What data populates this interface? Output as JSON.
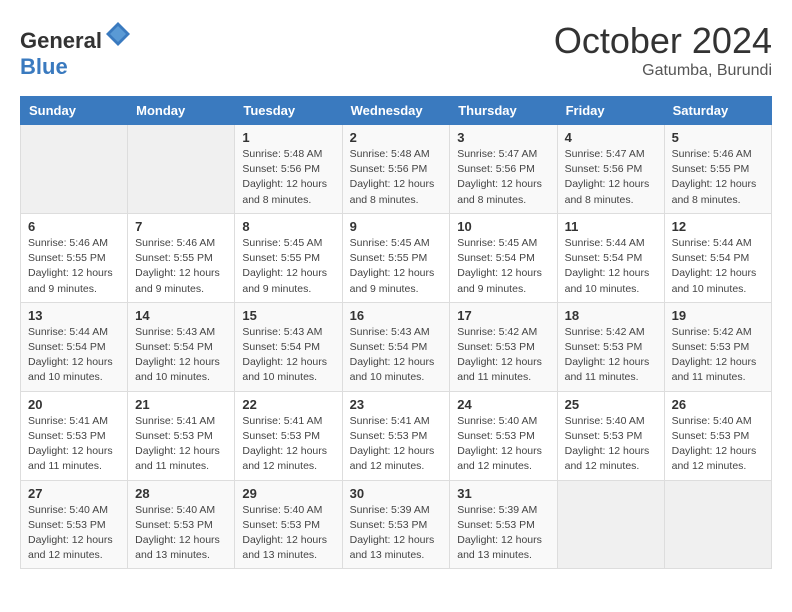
{
  "header": {
    "logo_general": "General",
    "logo_blue": "Blue",
    "month_title": "October 2024",
    "location": "Gatumba, Burundi"
  },
  "days_of_week": [
    "Sunday",
    "Monday",
    "Tuesday",
    "Wednesday",
    "Thursday",
    "Friday",
    "Saturday"
  ],
  "weeks": [
    [
      {
        "day": "",
        "detail": ""
      },
      {
        "day": "",
        "detail": ""
      },
      {
        "day": "1",
        "detail": "Sunrise: 5:48 AM\nSunset: 5:56 PM\nDaylight: 12 hours and 8 minutes."
      },
      {
        "day": "2",
        "detail": "Sunrise: 5:48 AM\nSunset: 5:56 PM\nDaylight: 12 hours and 8 minutes."
      },
      {
        "day": "3",
        "detail": "Sunrise: 5:47 AM\nSunset: 5:56 PM\nDaylight: 12 hours and 8 minutes."
      },
      {
        "day": "4",
        "detail": "Sunrise: 5:47 AM\nSunset: 5:56 PM\nDaylight: 12 hours and 8 minutes."
      },
      {
        "day": "5",
        "detail": "Sunrise: 5:46 AM\nSunset: 5:55 PM\nDaylight: 12 hours and 8 minutes."
      }
    ],
    [
      {
        "day": "6",
        "detail": "Sunrise: 5:46 AM\nSunset: 5:55 PM\nDaylight: 12 hours and 9 minutes."
      },
      {
        "day": "7",
        "detail": "Sunrise: 5:46 AM\nSunset: 5:55 PM\nDaylight: 12 hours and 9 minutes."
      },
      {
        "day": "8",
        "detail": "Sunrise: 5:45 AM\nSunset: 5:55 PM\nDaylight: 12 hours and 9 minutes."
      },
      {
        "day": "9",
        "detail": "Sunrise: 5:45 AM\nSunset: 5:55 PM\nDaylight: 12 hours and 9 minutes."
      },
      {
        "day": "10",
        "detail": "Sunrise: 5:45 AM\nSunset: 5:54 PM\nDaylight: 12 hours and 9 minutes."
      },
      {
        "day": "11",
        "detail": "Sunrise: 5:44 AM\nSunset: 5:54 PM\nDaylight: 12 hours and 10 minutes."
      },
      {
        "day": "12",
        "detail": "Sunrise: 5:44 AM\nSunset: 5:54 PM\nDaylight: 12 hours and 10 minutes."
      }
    ],
    [
      {
        "day": "13",
        "detail": "Sunrise: 5:44 AM\nSunset: 5:54 PM\nDaylight: 12 hours and 10 minutes."
      },
      {
        "day": "14",
        "detail": "Sunrise: 5:43 AM\nSunset: 5:54 PM\nDaylight: 12 hours and 10 minutes."
      },
      {
        "day": "15",
        "detail": "Sunrise: 5:43 AM\nSunset: 5:54 PM\nDaylight: 12 hours and 10 minutes."
      },
      {
        "day": "16",
        "detail": "Sunrise: 5:43 AM\nSunset: 5:54 PM\nDaylight: 12 hours and 10 minutes."
      },
      {
        "day": "17",
        "detail": "Sunrise: 5:42 AM\nSunset: 5:53 PM\nDaylight: 12 hours and 11 minutes."
      },
      {
        "day": "18",
        "detail": "Sunrise: 5:42 AM\nSunset: 5:53 PM\nDaylight: 12 hours and 11 minutes."
      },
      {
        "day": "19",
        "detail": "Sunrise: 5:42 AM\nSunset: 5:53 PM\nDaylight: 12 hours and 11 minutes."
      }
    ],
    [
      {
        "day": "20",
        "detail": "Sunrise: 5:41 AM\nSunset: 5:53 PM\nDaylight: 12 hours and 11 minutes."
      },
      {
        "day": "21",
        "detail": "Sunrise: 5:41 AM\nSunset: 5:53 PM\nDaylight: 12 hours and 11 minutes."
      },
      {
        "day": "22",
        "detail": "Sunrise: 5:41 AM\nSunset: 5:53 PM\nDaylight: 12 hours and 12 minutes."
      },
      {
        "day": "23",
        "detail": "Sunrise: 5:41 AM\nSunset: 5:53 PM\nDaylight: 12 hours and 12 minutes."
      },
      {
        "day": "24",
        "detail": "Sunrise: 5:40 AM\nSunset: 5:53 PM\nDaylight: 12 hours and 12 minutes."
      },
      {
        "day": "25",
        "detail": "Sunrise: 5:40 AM\nSunset: 5:53 PM\nDaylight: 12 hours and 12 minutes."
      },
      {
        "day": "26",
        "detail": "Sunrise: 5:40 AM\nSunset: 5:53 PM\nDaylight: 12 hours and 12 minutes."
      }
    ],
    [
      {
        "day": "27",
        "detail": "Sunrise: 5:40 AM\nSunset: 5:53 PM\nDaylight: 12 hours and 12 minutes."
      },
      {
        "day": "28",
        "detail": "Sunrise: 5:40 AM\nSunset: 5:53 PM\nDaylight: 12 hours and 13 minutes."
      },
      {
        "day": "29",
        "detail": "Sunrise: 5:40 AM\nSunset: 5:53 PM\nDaylight: 12 hours and 13 minutes."
      },
      {
        "day": "30",
        "detail": "Sunrise: 5:39 AM\nSunset: 5:53 PM\nDaylight: 12 hours and 13 minutes."
      },
      {
        "day": "31",
        "detail": "Sunrise: 5:39 AM\nSunset: 5:53 PM\nDaylight: 12 hours and 13 minutes."
      },
      {
        "day": "",
        "detail": ""
      },
      {
        "day": "",
        "detail": ""
      }
    ]
  ]
}
